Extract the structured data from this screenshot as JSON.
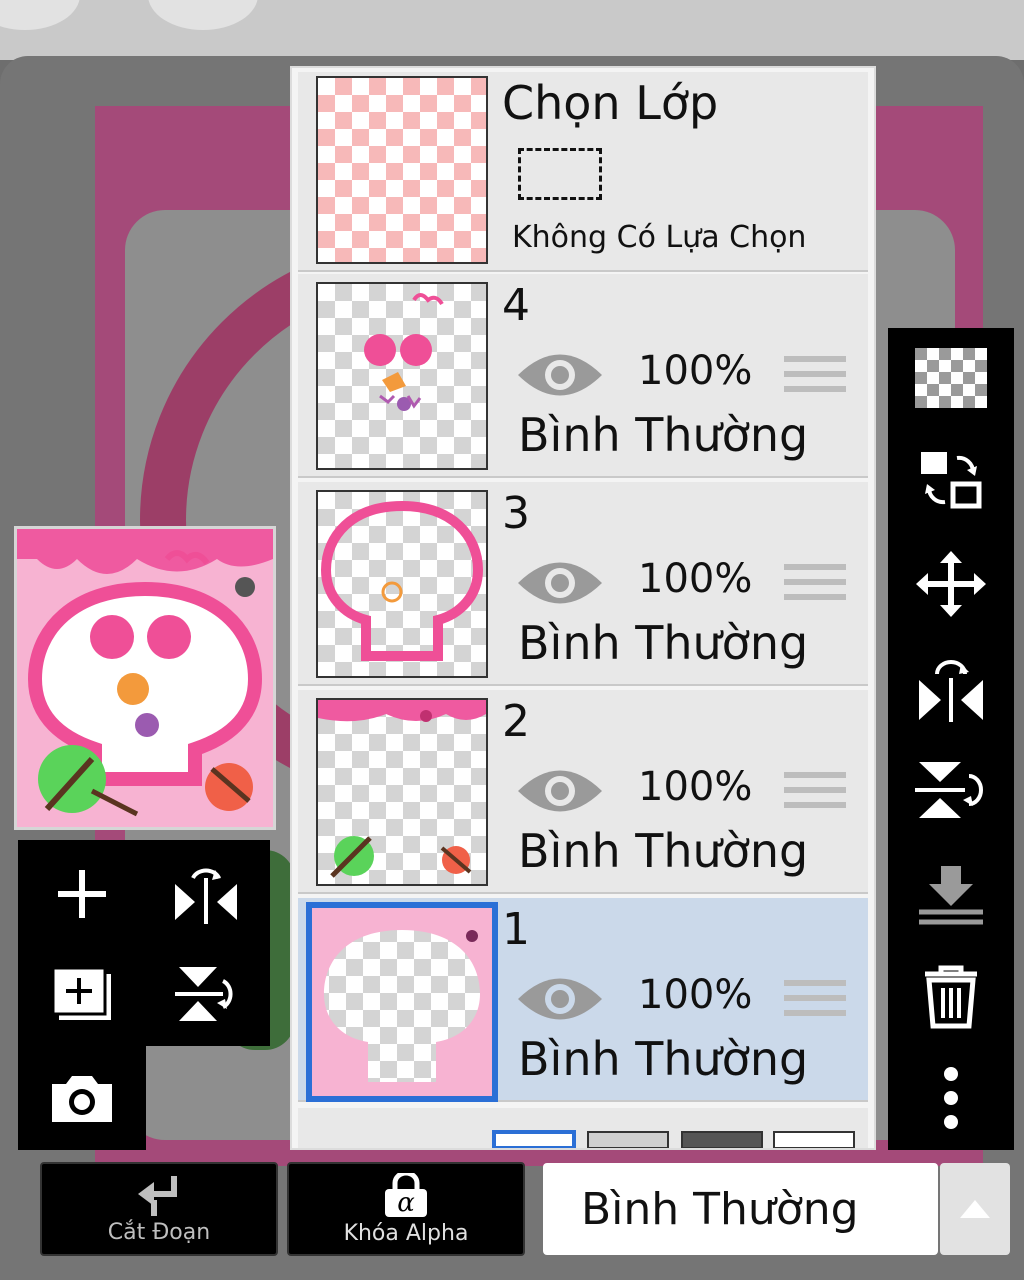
{
  "selection_layer": {
    "title": "Chọn Lớp",
    "subtitle": "Không Có Lựa Chọn"
  },
  "layers": [
    {
      "number": "4",
      "opacity": "100%",
      "blend_mode": "Bình Thường",
      "selected": false
    },
    {
      "number": "3",
      "opacity": "100%",
      "blend_mode": "Bình Thường",
      "selected": false
    },
    {
      "number": "2",
      "opacity": "100%",
      "blend_mode": "Bình Thường",
      "selected": false
    },
    {
      "number": "1",
      "opacity": "100%",
      "blend_mode": "Bình Thường",
      "selected": true
    }
  ],
  "bottom_bar": {
    "clip_label": "Cắt Đoạn",
    "alpha_lock_label": "Khóa Alpha",
    "blend_mode_value": "Bình Thường"
  },
  "left_tools": [
    "add-layer-icon",
    "flip-horizontal-icon",
    "add-copy-layer-icon",
    "flip-vertical-icon",
    "camera-icon"
  ],
  "right_tools": [
    "transparency-icon",
    "swap-layer-icon",
    "move-icon",
    "flip-horizontal-icon",
    "flip-vertical-icon",
    "merge-down-icon",
    "trash-icon",
    "more-vert-icon"
  ],
  "colors": {
    "accent_pink": "#ef5aa0",
    "selected_layer_bg": "#cbd9ea",
    "selected_border": "#2b6fd6"
  }
}
